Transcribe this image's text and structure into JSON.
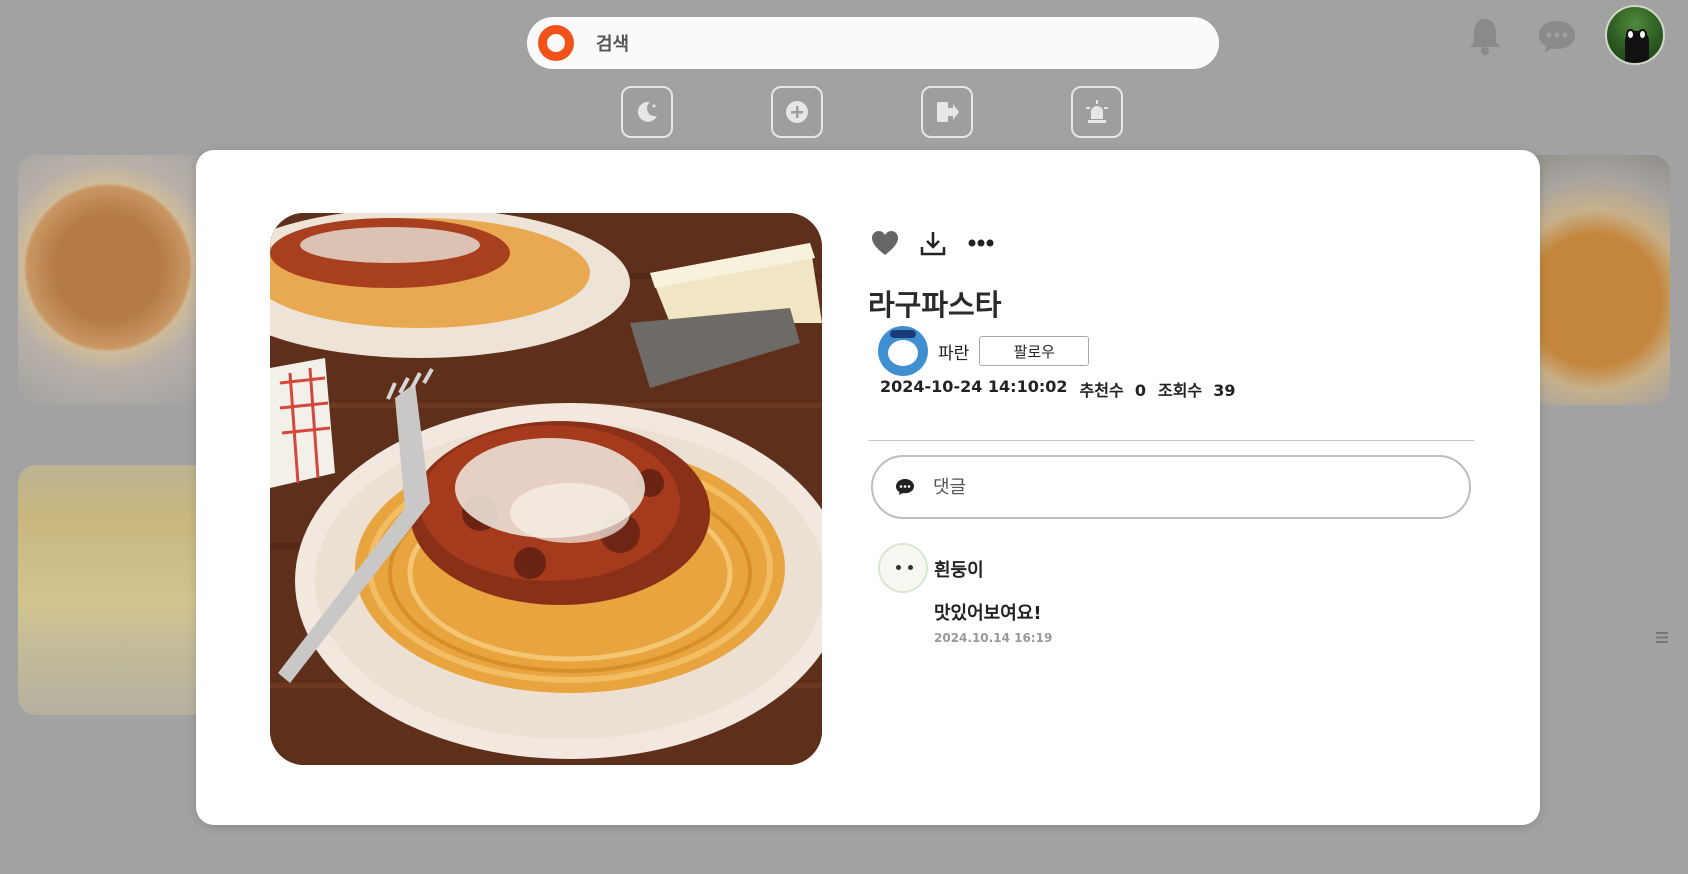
{
  "search": {
    "placeholder": "검색"
  },
  "modal": {
    "title": "라구파스타",
    "author": {
      "name": "파란",
      "follow_label": "팔로우"
    },
    "meta": {
      "datetime": "2024-10-24 14:10:02",
      "likes_label": "추천수",
      "likes_value": "0",
      "views_label": "조회수",
      "views_value": "39"
    },
    "comment_input": {
      "placeholder": "댓글"
    },
    "comments": [
      {
        "author": "흰둥이",
        "text": "맛있어보여요!",
        "date": "2024.10.14 16:19"
      }
    ]
  },
  "icons": {
    "search_logo": "app-logo-icon",
    "notifications": "bell-icon",
    "messages": "chat-bubble-icon",
    "theme_toggle": "moon-icon",
    "create": "plus-circle-icon",
    "logout": "logout-icon",
    "alert": "siren-icon",
    "like": "heart-icon",
    "download": "download-icon",
    "more": "more-icon",
    "comment": "comment-icon",
    "comment_menu": "menu-icon"
  },
  "colors": {
    "brand": "#f0521a",
    "overlay": "#a2a2a2",
    "modal_bg": "#ffffff",
    "heart": "#666666"
  }
}
